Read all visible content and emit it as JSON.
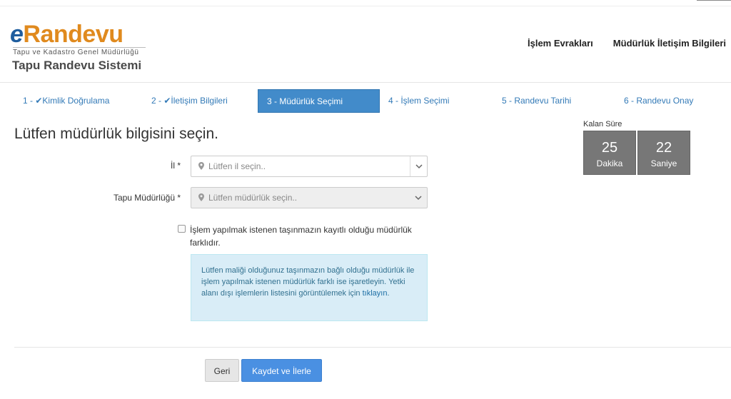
{
  "header": {
    "logo_e": "e",
    "logo_rest": "Randevu",
    "logo_subtitle": "Tapu ve Kadastro Genel Müdürlüğü",
    "system_title": "Tapu Randevu Sistemi",
    "nav": [
      "İşlem Evrakları",
      "Müdürlük İletişim Bilgileri"
    ]
  },
  "steps": [
    {
      "label": "1 - ",
      "check": "✔",
      "text": "Kimlik Doğrulama"
    },
    {
      "label": "2 - ",
      "check": "✔",
      "text": "İletişim Bilgileri"
    },
    {
      "label": "3 - ",
      "check": "",
      "text": "Müdürlük Seçimi"
    },
    {
      "label": "4 - ",
      "check": "",
      "text": "İşlem Seçimi"
    },
    {
      "label": "5 - ",
      "check": "",
      "text": "Randevu Tarihi"
    },
    {
      "label": "6 - ",
      "check": "",
      "text": "Randevu Onay"
    }
  ],
  "page_title": "Lütfen müdürlük bilgisini seçin.",
  "timer": {
    "label": "Kalan Süre",
    "minutes": "25",
    "minutes_unit": "Dakika",
    "seconds": "22",
    "seconds_unit": "Saniye"
  },
  "form": {
    "il_label": "İl *",
    "il_placeholder": "Lütfen il seçin..",
    "mudurluk_label": "Tapu Müdürlüğü *",
    "mudurluk_placeholder": "Lütfen müdürlük seçin..",
    "checkbox_label": "İşlem yapılmak istenen taşınmazın kayıtlı olduğu müdürlük farklıdır.",
    "checkbox_checked": false,
    "info_text": "Lütfen maliği olduğunuz taşınmazın bağlı olduğu müdürlük ile işlem yapılmak istenen müdürlük farklı ise işaretleyin. Yetki alanı dışı işlemlerin listesini görüntülemek için ",
    "info_link": "tıklayın",
    "info_end": "."
  },
  "buttons": {
    "back": "Geri",
    "next": "Kaydet ve İlerle"
  },
  "colors": {
    "brand_orange": "#e08a1e",
    "brand_blue": "#1f5d9e",
    "active_step": "#428bca",
    "link": "#337ab7",
    "timer_bg": "#777777",
    "info_bg": "#d9edf7",
    "primary_button": "#4a90e2"
  }
}
